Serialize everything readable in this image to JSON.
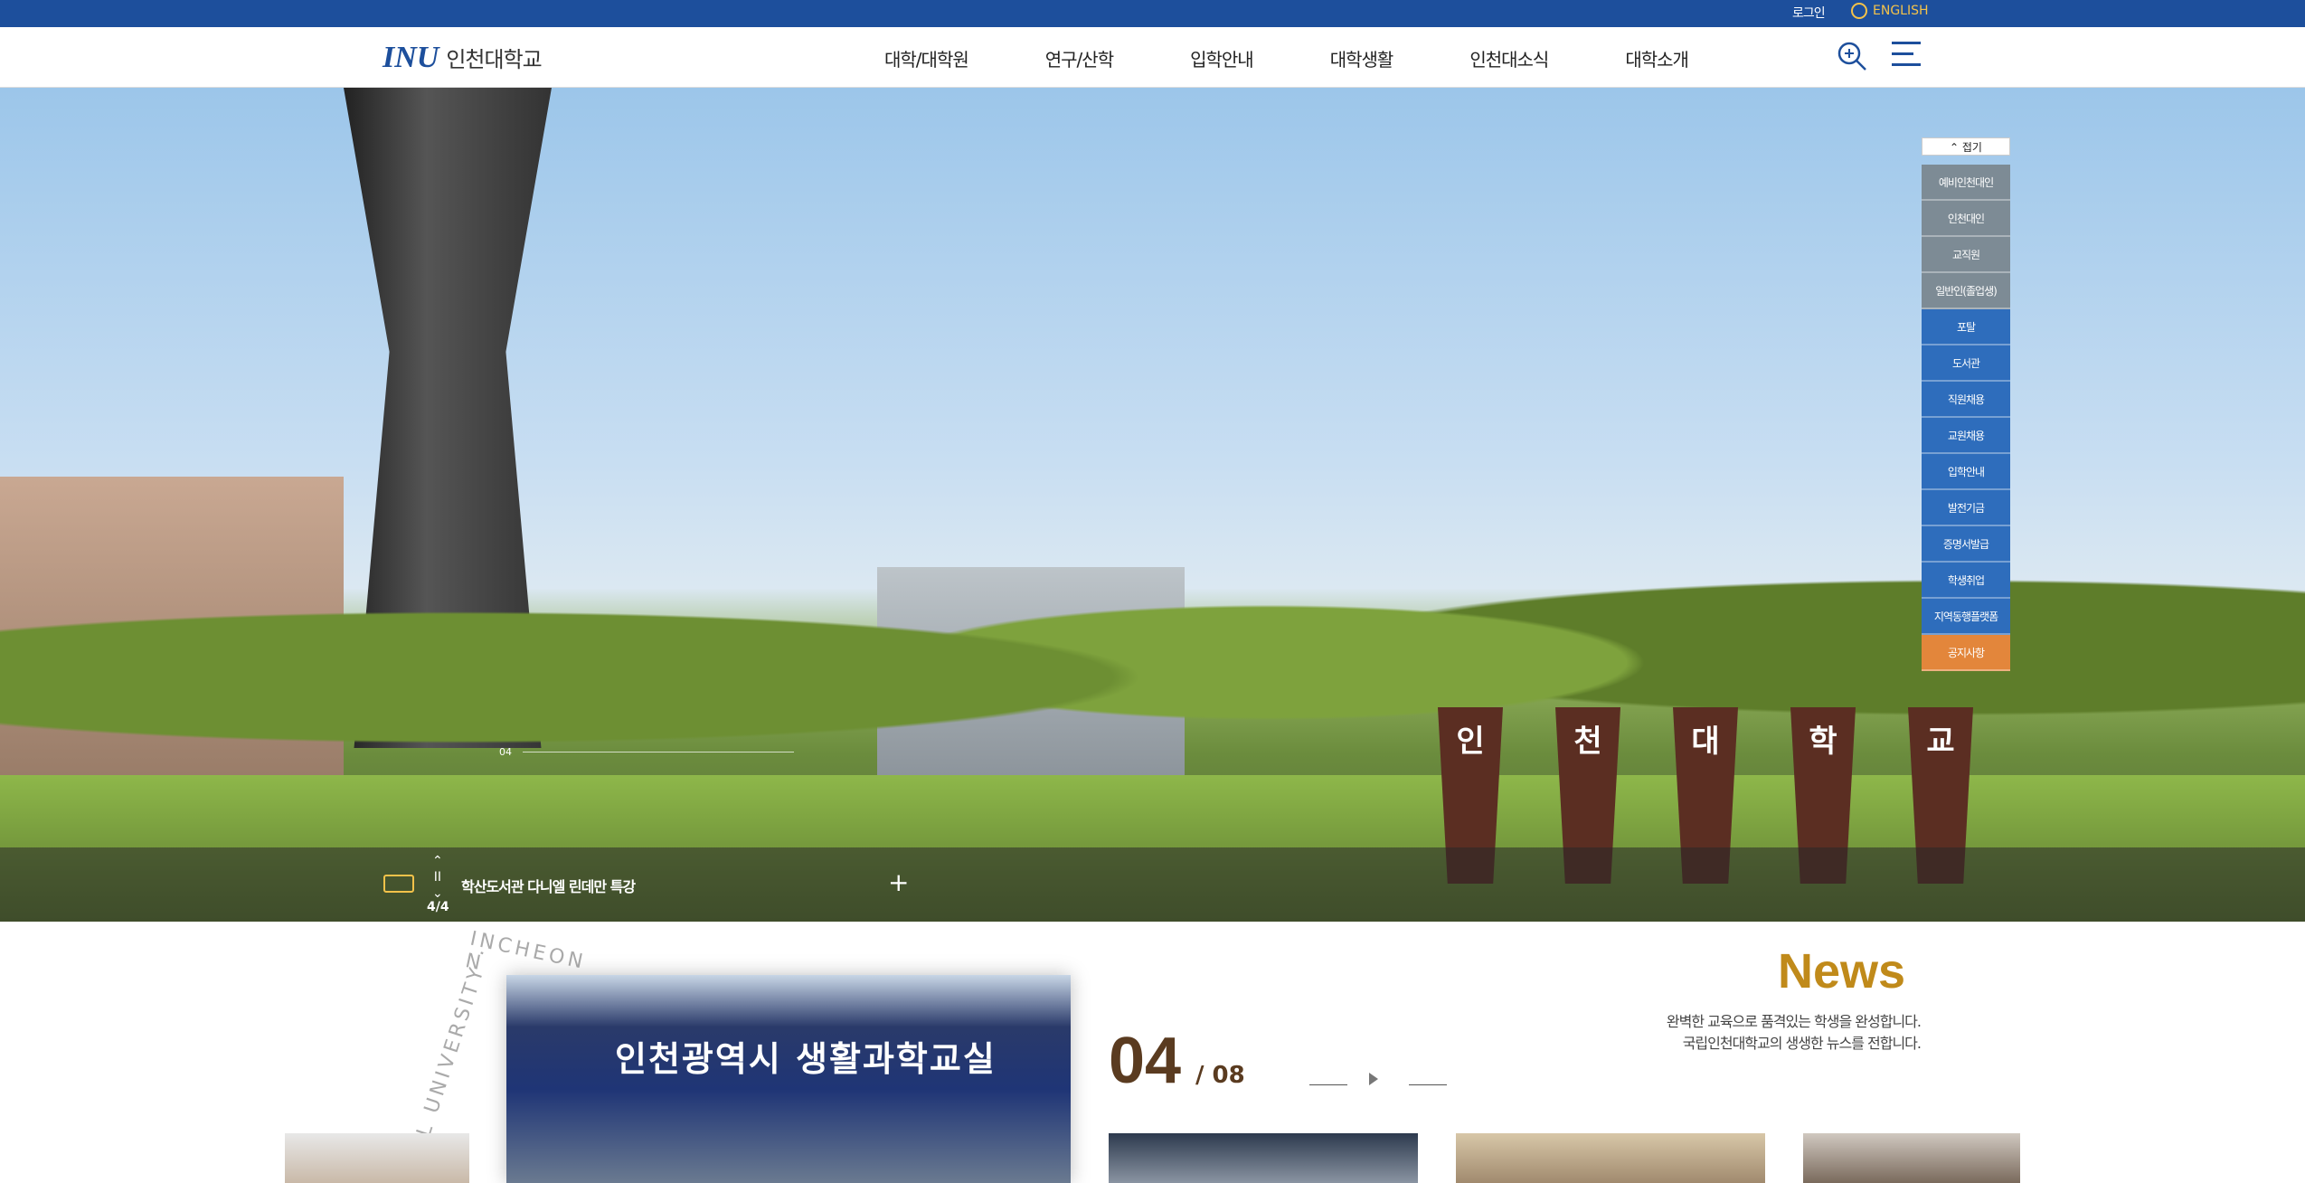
{
  "topbar": {
    "login": "로그인",
    "english": "ENGLISH"
  },
  "header": {
    "logo_mark": "INU",
    "logo_name": "인천대학교",
    "menu": [
      "대학/대학원",
      "연구/산학",
      "입학안내",
      "대학생활",
      "인천대소식",
      "대학소개"
    ]
  },
  "hero": {
    "sign_chars": [
      "인",
      "천",
      "대",
      "학",
      "교"
    ],
    "slide_indicator": "04",
    "ticker_text": "학산도서관 다니엘 린데만 특강",
    "ticker_count": "4/4",
    "ticker_controls": {
      "up": "⌃",
      "pause": "II",
      "down": "⌄"
    }
  },
  "quick_menu": {
    "fold_label": "접기",
    "items": [
      {
        "label": "예비인천대인",
        "color": "gray"
      },
      {
        "label": "인천대인",
        "color": "gray"
      },
      {
        "label": "교직원",
        "color": "gray"
      },
      {
        "label": "일반인(졸업생)",
        "color": "gray"
      },
      {
        "label": "포탈",
        "color": "blue"
      },
      {
        "label": "도서관",
        "color": "blue"
      },
      {
        "label": "직원채용",
        "color": "blue"
      },
      {
        "label": "교원채용",
        "color": "blue"
      },
      {
        "label": "입학안내",
        "color": "blue"
      },
      {
        "label": "발전기금",
        "color": "blue"
      },
      {
        "label": "증명서발급",
        "color": "blue"
      },
      {
        "label": "학생취업",
        "color": "blue"
      },
      {
        "label": "지역동행플랫폼",
        "color": "blue"
      },
      {
        "label": "공지사항",
        "color": "orange"
      }
    ]
  },
  "news": {
    "title": "News",
    "desc_line1": "완벽한 교육으로 품격있는 학생을 완성합니다.",
    "desc_line2": "국립인천대학교의 생생한 뉴스를 전합니다.",
    "current": "04",
    "total": "/ 08",
    "circle_text_top": "INCHEON N",
    "circle_text_side": "AL UNIVERSITY ·",
    "main_banner": "인천광역시 생활과학교실"
  },
  "colors": {
    "primary": "#1d4f9c",
    "accent": "#c08a1a",
    "orange": "#e3863b"
  }
}
